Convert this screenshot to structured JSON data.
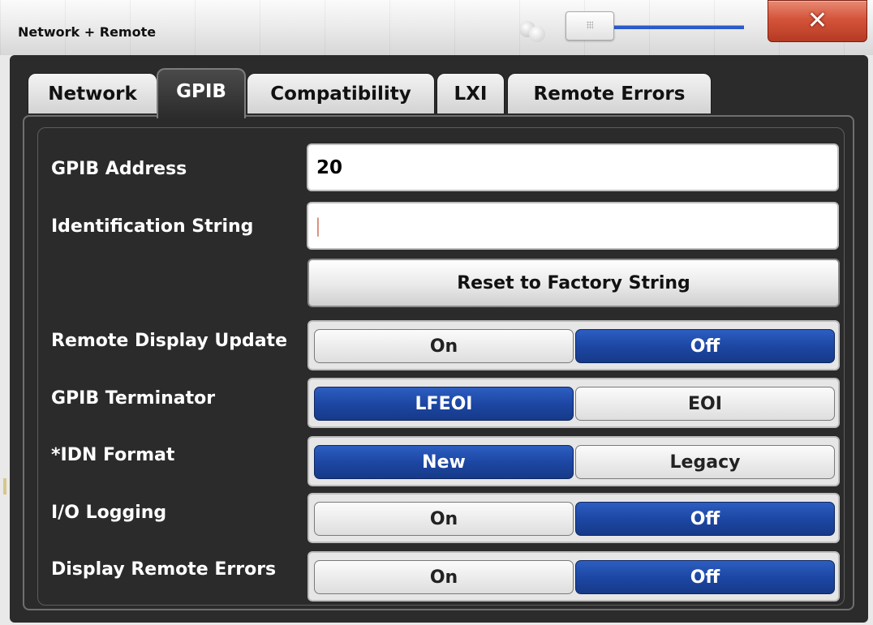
{
  "window": {
    "title": "Network + Remote",
    "close_icon": "close-icon"
  },
  "tabs": [
    {
      "label": "Network",
      "active": false
    },
    {
      "label": "GPIB",
      "active": true
    },
    {
      "label": "Compatibility",
      "active": false
    },
    {
      "label": "LXI",
      "active": false
    },
    {
      "label": "Remote Errors",
      "active": false
    }
  ],
  "gpib": {
    "address_label": "GPIB Address",
    "address_value": "20",
    "id_string_label": "Identification String",
    "id_string_value": "",
    "reset_button": "Reset to Factory String",
    "remote_display_update": {
      "label": "Remote Display Update",
      "left": "On",
      "right": "Off",
      "selected": "Off"
    },
    "terminator": {
      "label": "GPIB Terminator",
      "left": "LFEOI",
      "right": "EOI",
      "selected": "LFEOI"
    },
    "idn_format": {
      "label": "*IDN Format",
      "left": "New",
      "right": "Legacy",
      "selected": "New"
    },
    "io_logging": {
      "label": "I/O Logging",
      "left": "On",
      "right": "Off",
      "selected": "Off"
    },
    "display_remote_errors": {
      "label": "Display Remote Errors",
      "left": "On",
      "right": "Off",
      "selected": "Off"
    }
  },
  "colors": {
    "selected": "#1d47a4",
    "panel": "#2b2b2b",
    "close": "#d4543a"
  }
}
